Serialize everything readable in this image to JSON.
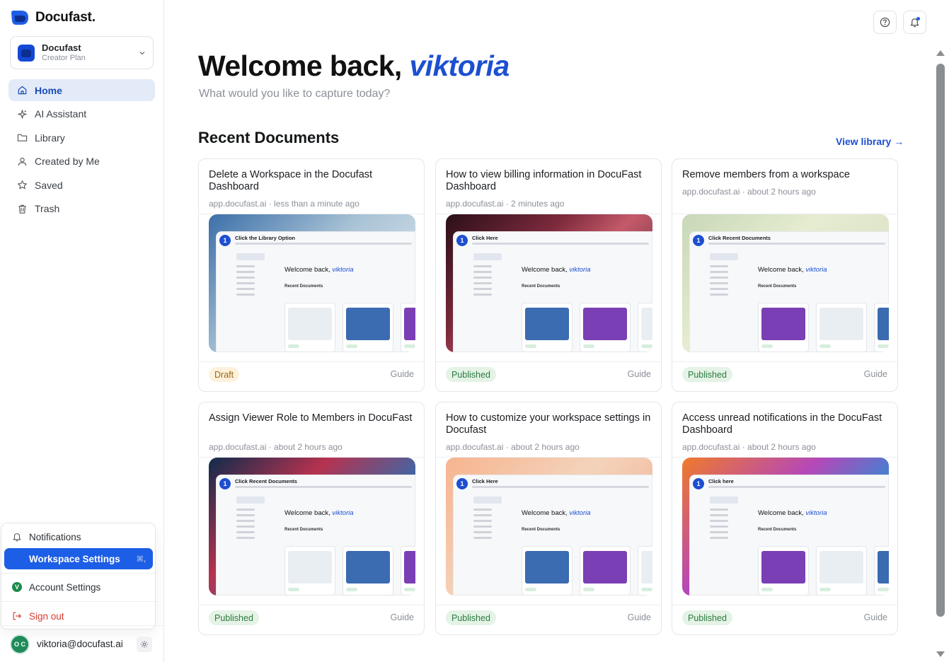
{
  "brand": {
    "name": "Docufast."
  },
  "workspace": {
    "name": "Docufast",
    "plan": "Creator Plan"
  },
  "nav": [
    {
      "label": "Home",
      "icon": "home-icon",
      "active": true
    },
    {
      "label": "AI Assistant",
      "icon": "sparkles-icon",
      "active": false
    },
    {
      "label": "Library",
      "icon": "folder-icon",
      "active": false
    },
    {
      "label": "Created by Me",
      "icon": "user-icon",
      "active": false
    },
    {
      "label": "Saved",
      "icon": "star-icon",
      "active": false
    },
    {
      "label": "Trash",
      "icon": "trash-icon",
      "active": false
    }
  ],
  "menu": {
    "notifications": "Notifications",
    "workspace_settings": "Workspace Settings",
    "workspace_shortcut": "⌘,",
    "account_settings": "Account Settings",
    "account_badge": "V",
    "sign_out": "Sign out"
  },
  "user": {
    "email": "viktoria@docufast.ai",
    "initials": "O C"
  },
  "header": {
    "welcome_prefix": "Welcome back, ",
    "username": "viktoria",
    "subtitle": "What would you like to capture today?"
  },
  "recent": {
    "title": "Recent Documents",
    "view_library": "View library →",
    "documents": [
      {
        "title": "Delete a Workspace in the Docufast Dashboard",
        "meta": "app.docufast.ai · less than a minute ago",
        "status": "Draft",
        "type": "Guide",
        "thumb_step": "Click the Library Option",
        "thumb_gradient": "linear-gradient(135deg,#3c6fa8 0%,#a9c3d6 45%,#e9eef2 100%)"
      },
      {
        "title": "How to view billing information in DocuFast Dashboard",
        "meta": "app.docufast.ai · 2 minutes ago",
        "status": "Published",
        "type": "Guide",
        "thumb_step": "Click Here",
        "thumb_gradient": "linear-gradient(135deg,#2a0f18 0%,#7d2a3c 35%,#c45a6a 55%,#3a1d2a 100%)"
      },
      {
        "title": "Remove members from a workspace",
        "meta": "app.docufast.ai · about 2 hours ago",
        "status": "Published",
        "type": "Guide",
        "thumb_step": "Click Recent Documents",
        "thumb_gradient": "linear-gradient(135deg,#c7d8b8 0%,#e6ecd0 40%,#d5dbc4 100%)"
      },
      {
        "title": "Assign Viewer Role to Members in DocuFast",
        "meta": "app.docufast.ai · about 2 hours ago",
        "status": "Published",
        "type": "Guide",
        "thumb_step": "Click Recent Documents",
        "thumb_gradient": "linear-gradient(135deg,#0f2b4c 0%,#b6324f 35%,#2c6fb2 70%,#18436f 100%)"
      },
      {
        "title": "How to customize your workspace settings in Docufast",
        "meta": "app.docufast.ai · about 2 hours ago",
        "status": "Published",
        "type": "Guide",
        "thumb_step": "Click Here",
        "thumb_gradient": "linear-gradient(135deg,#f6b48f 0%,#f4d3bb 45%,#f0a888 100%)"
      },
      {
        "title": "Access unread notifications in the DocuFast Dashboard",
        "meta": "app.docufast.ai · about 2 hours ago",
        "status": "Published",
        "type": "Guide",
        "thumb_step": "Click here",
        "thumb_gradient": "linear-gradient(135deg,#f07a2a 0%,#b548b8 40%,#2d8bd6 70%,#6d2fb8 100%)"
      }
    ]
  },
  "colors": {
    "accent": "#1d4fd1",
    "active_nav_bg": "#e3ebf8",
    "menu_active": "#1d5ee6"
  }
}
